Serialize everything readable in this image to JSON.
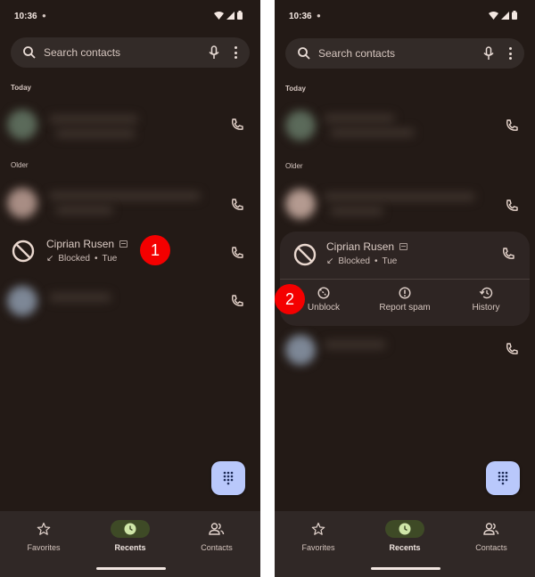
{
  "status_bar": {
    "time": "10:36"
  },
  "search": {
    "placeholder": "Search contacts"
  },
  "sections": {
    "today": "Today",
    "older": "Older"
  },
  "blocked_entry": {
    "name": "Ciprian Rusen",
    "status": "Blocked",
    "separator": "•",
    "day": "Tue"
  },
  "expanded_actions": [
    {
      "label": "Unblock",
      "icon": "unblock-icon"
    },
    {
      "label": "Report spam",
      "icon": "report-spam-icon"
    },
    {
      "label": "History",
      "icon": "history-icon"
    }
  ],
  "nav": {
    "items": [
      {
        "label": "Favorites",
        "icon": "star-icon"
      },
      {
        "label": "Recents",
        "icon": "clock-icon",
        "active": true
      },
      {
        "label": "Contacts",
        "icon": "contacts-icon"
      }
    ]
  },
  "markers": {
    "left": "1",
    "right": "2"
  },
  "colors": {
    "background": "#231a16",
    "surface": "#332b28",
    "fab": "#b9c8fb",
    "active_pill": "#3e4a26",
    "marker": "#f40000"
  }
}
